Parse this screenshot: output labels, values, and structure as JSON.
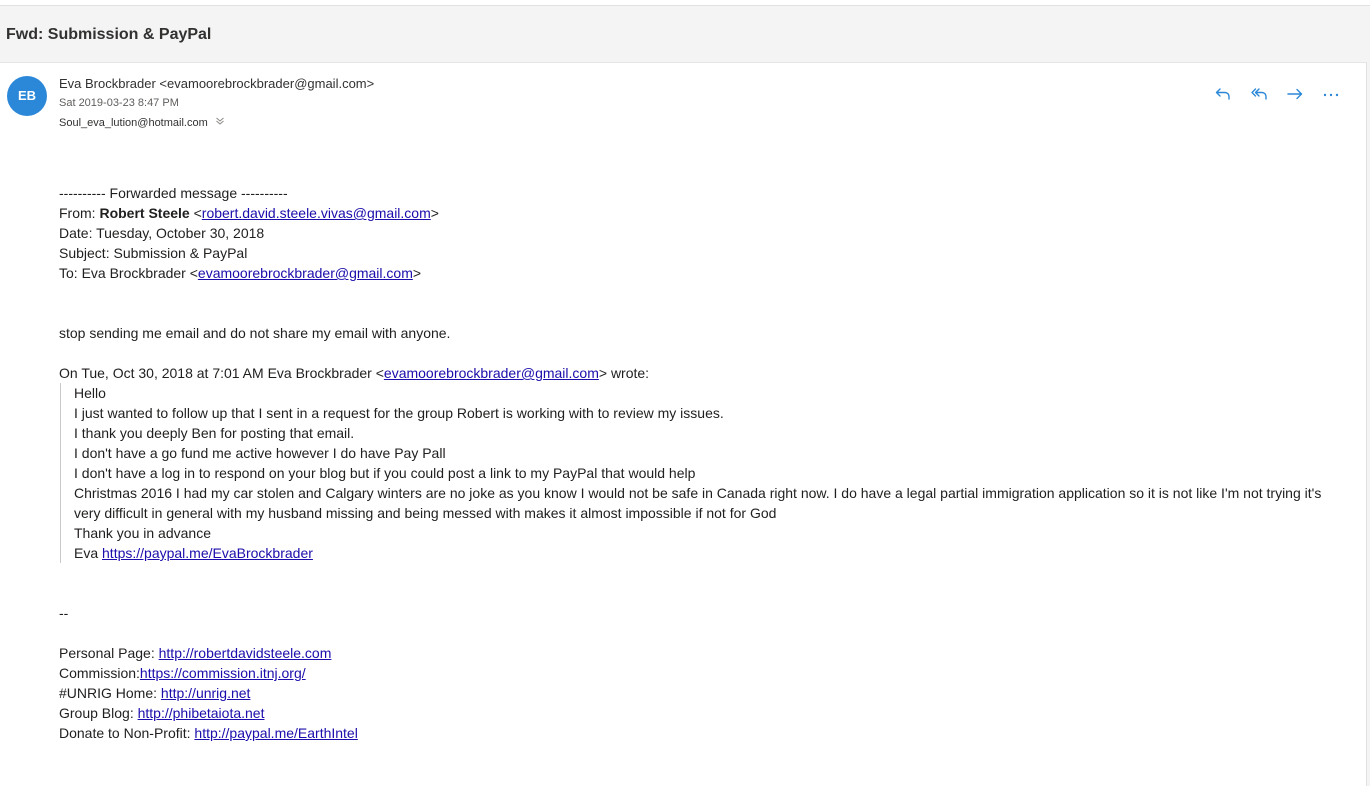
{
  "subject": "Fwd: Submission & PayPal",
  "message": {
    "avatar_initials": "EB",
    "sender": "Eva Brockbrader <evamoorebrockbrader@gmail.com>",
    "date": "Sat 2019-03-23 8:47 PM",
    "recipient": "Soul_eva_lution@hotmail.com"
  },
  "icons": {
    "reply": "reply-icon",
    "reply_all": "reply-all-icon",
    "forward": "forward-icon",
    "more": "more-icon",
    "expand": "chevron-down-icon"
  },
  "colors": {
    "accent": "#2b88d8",
    "action_icon": "#2b88d8",
    "link": "#1a0dab"
  },
  "forward": {
    "separator": "---------- Forwarded message ----------",
    "from_label": "From:",
    "from_name": "Robert Steele",
    "from_email": "robert.david.steele.vivas@gmail.com",
    "date_line": "Date: Tuesday, October 30, 2018",
    "subject_line": "Subject: Submission & PayPal",
    "to_prefix": "To: Eva Brockbrader <",
    "to_email": "evamoorebrockbrader@gmail.com",
    "reply_text": "stop sending me email and do not share my email with anyone.",
    "quote_intro_prefix": "On Tue, Oct 30, 2018 at 7:01 AM Eva Brockbrader <",
    "quote_intro_email": "evamoorebrockbrader@gmail.com",
    "quote_intro_suffix": "> wrote:"
  },
  "quote": {
    "l1": "Hello",
    "l2": "I just wanted to follow up that I sent in a request for the group Robert is working with to review my issues.",
    "l3": "I thank you deeply Ben for posting that email.",
    "l4": "I don't have a go fund me active however I do have Pay Pall",
    "l5": "I don't have a log in to respond on your blog but if you could post a link to my PayPal that would help",
    "l6": "Christmas 2016 I had my car stolen and Calgary winters are no joke as you know I would not be safe in Canada right now. I do have a legal partial immigration application so it is not like I'm not trying it's very difficult in general with my husband missing and being messed with makes it almost impossible if not for God",
    "l7": "Thank you in advance",
    "sig_name": "Eva ",
    "sig_link": "https://paypal.me/EvaBrockbrader"
  },
  "signature": {
    "dash": "--",
    "personal_label": "Personal Page: ",
    "personal_link": "http://robertdavidsteele.com",
    "commission_label": "Commission:",
    "commission_link": "https://commission.itnj.org/",
    "unrig_label": "#UNRIG Home: ",
    "unrig_link": "http://unrig.net",
    "blog_label": "Group Blog: ",
    "blog_link": "http://phibetaiota.net",
    "donate_label": "Donate to Non-Profit: ",
    "donate_link": "http://paypal.me/EarthIntel"
  }
}
